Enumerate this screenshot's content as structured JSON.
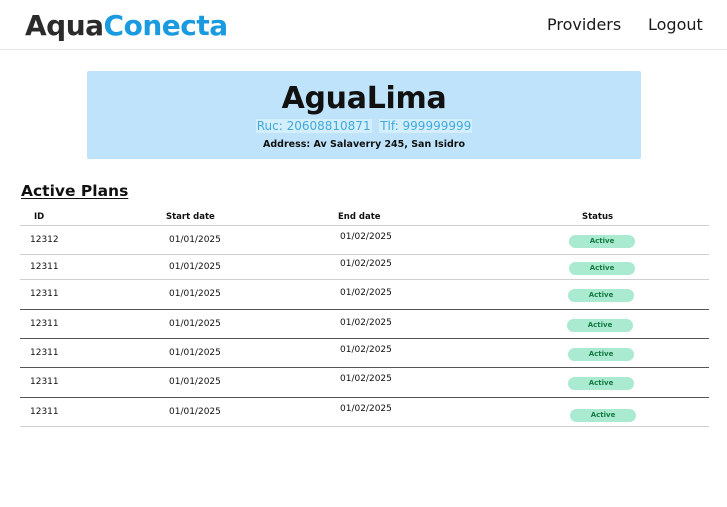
{
  "header": {
    "logo_part1": "Aqua",
    "logo_part2": "Conecta",
    "nav": {
      "providers": "Providers",
      "logout": "Logout"
    }
  },
  "provider": {
    "name": "AguaLima",
    "ruc": "Ruc: 20608810871",
    "phone": "Tlf: 999999999",
    "address": "Address: Av Salaverry 245, San Isidro"
  },
  "section_title": "Active Plans",
  "table": {
    "headers": {
      "id": "ID",
      "start": "Start date",
      "end": "End date",
      "status": "Status"
    },
    "rows": [
      {
        "id": "12312",
        "start": "01/01/2025",
        "end": "01/02/2025",
        "status": "Active"
      },
      {
        "id": "12311",
        "start": "01/01/2025",
        "end": "01/02/2025",
        "status": "Active"
      },
      {
        "id": "12311",
        "start": "01/01/2025",
        "end": "01/02/2025",
        "status": "Active"
      },
      {
        "id": "12311",
        "start": "01/01/2025",
        "end": "01/02/2025",
        "status": "Active"
      },
      {
        "id": "12311",
        "start": "01/01/2025",
        "end": "01/02/2025",
        "status": "Active"
      },
      {
        "id": "12311",
        "start": "01/01/2025",
        "end": "01/02/2025",
        "status": "Active"
      },
      {
        "id": "12311",
        "start": "01/01/2025",
        "end": "01/02/2025",
        "status": "Active"
      }
    ]
  },
  "colors": {
    "brand_blue": "#1a9be0",
    "card_bg": "#bfe3fb",
    "badge_bg": "#a9ead0",
    "badge_text": "#167a43"
  }
}
